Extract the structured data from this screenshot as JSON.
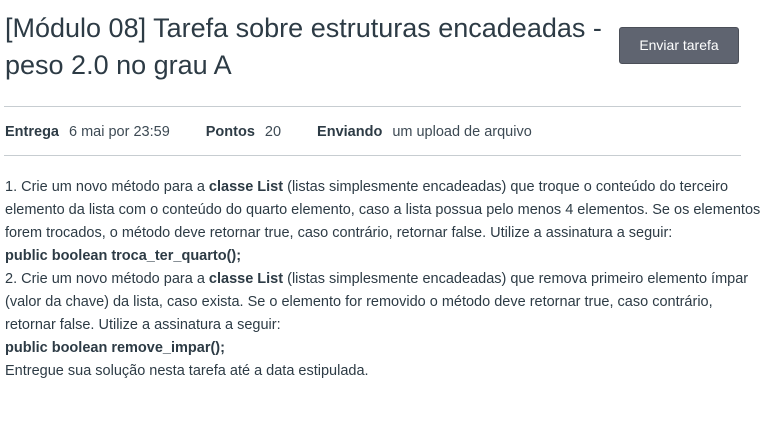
{
  "assignment": {
    "title": "[Módulo 08] Tarefa sobre estruturas encadeadas - peso 2.0 no grau A",
    "submit_label": "Enviar tarefa"
  },
  "details": {
    "due_label": "Entrega",
    "due_value": "6 mai por 23:59",
    "points_label": "Pontos",
    "points_value": "20",
    "submitting_label": "Enviando",
    "submitting_value": "um upload de arquivo"
  },
  "description": {
    "item1_prefix": "1. Crie um novo método para a ",
    "item1_class": "classe List",
    "item1_suffix": " (listas simplesmente encadeadas) que troque o conteúdo do terceiro elemento da lista com o conteúdo do quarto elemento, caso a lista possua pelo menos 4 elementos. Se os elementos forem trocados, o método deve retornar true, caso contrário, retornar false. Utilize a assinatura a seguir:",
    "item1_signature": "public boolean troca_ter_quarto();",
    "item2_prefix": "2. Crie um novo método para a ",
    "item2_class": "classe List",
    "item2_suffix": " (listas simplesmente encadeadas)  que remova primeiro elemento ímpar (valor da chave) da lista, caso exista. Se o elemento for removido o método deve retornar true, caso contrário, retornar false. Utilize a assinatura a seguir:",
    "item2_signature": "public boolean remove_impar();",
    "closing": "Entregue sua solução nesta tarefa até a data estipulada."
  },
  "colors": {
    "text": "#2d3b45",
    "button_bg": "#5f6470",
    "button_text": "#ffffff",
    "divider": "#c7cdd1"
  }
}
